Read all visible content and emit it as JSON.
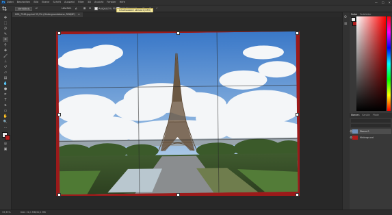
{
  "app": {
    "logo": "Ps"
  },
  "menu": [
    "Datei",
    "Bearbeiten",
    "Bild",
    "Ebene",
    "Schrift",
    "Auswahl",
    "Filter",
    "3D",
    "Ansicht",
    "Fenster",
    "Hilfe"
  ],
  "window_controls": {
    "minimize": "—",
    "maximize": "□",
    "close": "✕"
  },
  "options": {
    "tool_icon": "crop-icon",
    "ratio_select": "Verhältnis",
    "clear_label": "Löschen",
    "straighten_label": "Gerade ausrichten",
    "delete_pixels_label": "Ausgeschn. Pixel löschen",
    "content_aware_label": "Inhaltsbasiert",
    "reset_label": "↺",
    "cancel_label": "⊘",
    "commit_label": "✓"
  },
  "tooltip": "Inhaltsbasiert aktiviert (GPU)",
  "document_tab": {
    "title": "IMG_7345.jpg bei 33,3% (Hintergrundebene, RGB/8*)",
    "close": "×"
  },
  "status": {
    "zoom": "33,33%",
    "doc_info": "Dok: 20,1 MB/20,1 MB"
  },
  "panels": {
    "color_tabs": [
      "Farbe",
      "Farbfelder"
    ],
    "layer_tabs": [
      "Ebenen",
      "Kanäle",
      "Pfade"
    ],
    "layers": [
      {
        "name": "Ebene 0",
        "visible": true
      },
      {
        "name": "Hintergrund",
        "visible": true
      }
    ]
  },
  "colors": {
    "fg": "#e8e8e8",
    "bg": "#b01c1c",
    "accent": "#31a8ff",
    "doc_border": "#9b1a1a"
  }
}
